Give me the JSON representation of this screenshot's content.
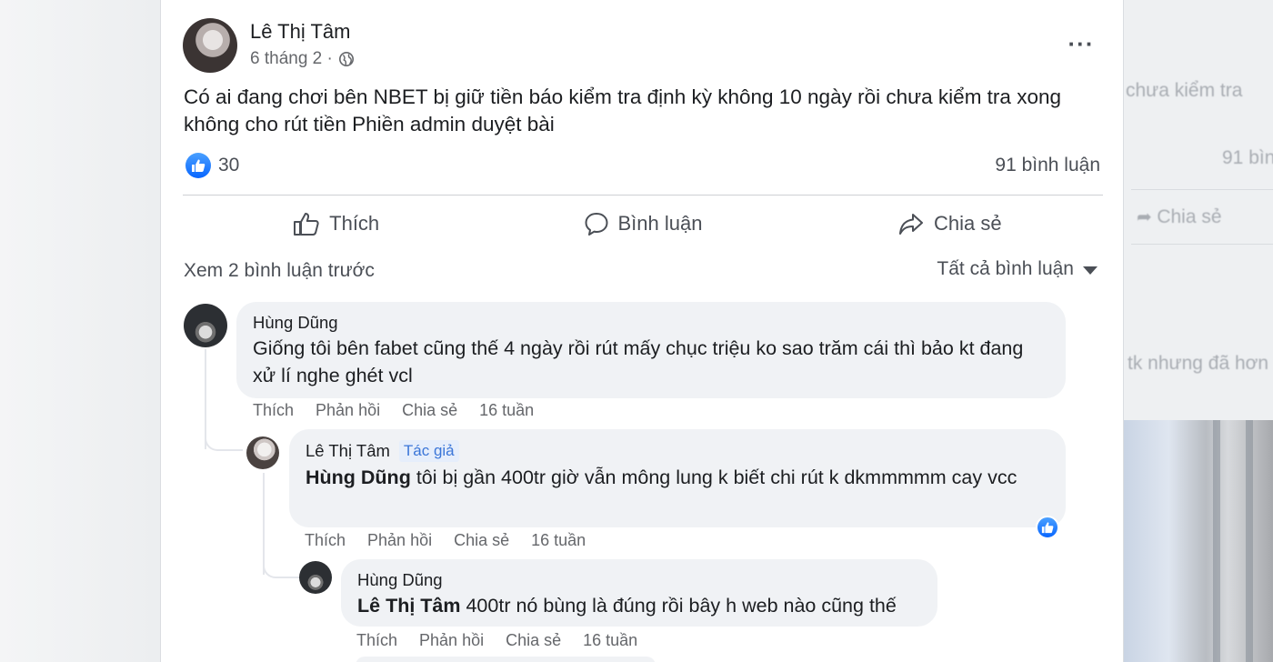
{
  "background": {
    "right_ghost": [
      "chưa kiểm tra",
      "91 bìn",
      "Chia sẻ",
      "tk nhưng đã hơn"
    ]
  },
  "post": {
    "author": "Lê Thị Tâm",
    "date": "6 tháng 2 ·",
    "privacy_icon": "globe-icon",
    "more_icon": "more-options-icon",
    "text": "Có ai đang chơi bên NBET bị giữ tiền báo kiểm tra định kỳ không 10 ngày rồi chưa kiểm tra xong không cho rút tiền Phiền admin duyệt bài",
    "like_count": "30",
    "comment_count": "91 bình luận"
  },
  "actions": {
    "like": "Thích",
    "comment": "Bình luận",
    "share": "Chia sẻ"
  },
  "comments_header": {
    "view_previous": "Xem 2 bình luận trước",
    "filter": "Tất cả bình luận"
  },
  "comments": [
    {
      "author": "Hùng Dũng",
      "text": "Giống tôi bên fabet cũng thế 4 ngày rồi rút mấy chục triệu ko sao trăm cái thì bảo kt đang xử lí nghe ghét vcl",
      "actions": [
        "Thích",
        "Phản hồi",
        "Chia sẻ"
      ],
      "time": "16 tuần"
    },
    {
      "author": "Lê Thị Tâm",
      "badge": "Tác giả",
      "mention": "Hùng Dũng",
      "text": "tôi bị gần 400tr giờ vẫn mông lung k biết chi rút k dkmmmmm cay vcc",
      "actions": [
        "Thích",
        "Phản hồi",
        "Chia sẻ"
      ],
      "time": "16 tuần",
      "reaction": "like"
    },
    {
      "author": "Hùng Dũng",
      "mention": "Lê Thị Tâm",
      "text": "400tr nó bùng là đúng rồi bây h web nào cũng thế",
      "actions": [
        "Thích",
        "Phản hồi",
        "Chia sẻ"
      ],
      "time": "16 tuần"
    }
  ],
  "colors": {
    "facebook_blue": "#0866ff",
    "bubble_bg": "#f0f2f5",
    "secondary_text": "#65676b"
  }
}
